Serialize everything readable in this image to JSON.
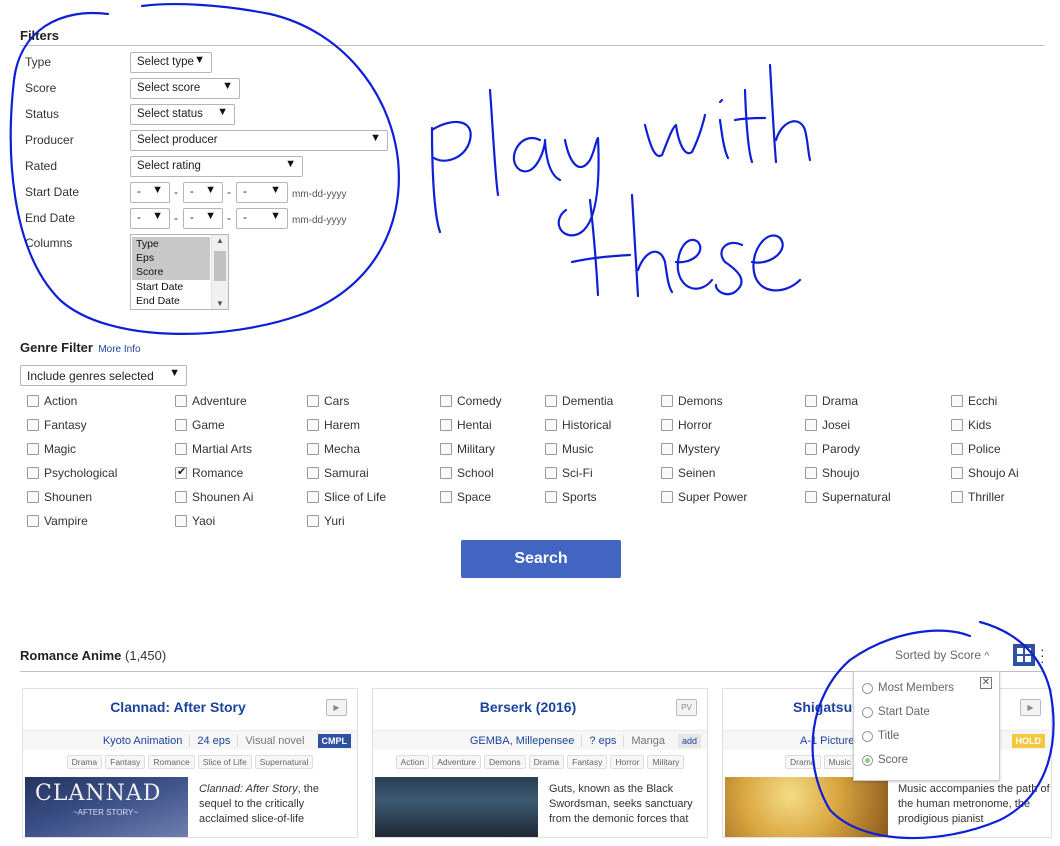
{
  "filters": {
    "heading": "Filters",
    "type": {
      "label": "Type",
      "value": "Select type"
    },
    "score": {
      "label": "Score",
      "value": "Select score"
    },
    "status": {
      "label": "Status",
      "value": "Select status"
    },
    "producer": {
      "label": "Producer",
      "value": "Select producer"
    },
    "rated": {
      "label": "Rated",
      "value": "Select rating"
    },
    "start_date": {
      "label": "Start Date",
      "month": "-",
      "day": "-",
      "year": "-",
      "format": "mm-dd-yyyy"
    },
    "end_date": {
      "label": "End Date",
      "month": "-",
      "day": "-",
      "year": "-",
      "format": "mm-dd-yyyy"
    },
    "columns": {
      "label": "Columns",
      "options": [
        "Type",
        "Eps",
        "Score",
        "Start Date",
        "End Date"
      ],
      "selected": [
        "Type",
        "Eps",
        "Score"
      ]
    }
  },
  "genre_filter": {
    "heading": "Genre Filter",
    "more_info": "More Info",
    "mode": "Include genres selected",
    "genres": [
      "Action",
      "Adventure",
      "Cars",
      "Comedy",
      "Dementia",
      "Demons",
      "Drama",
      "Ecchi",
      "Fantasy",
      "Game",
      "Harem",
      "Hentai",
      "Historical",
      "Horror",
      "Josei",
      "Kids",
      "Magic",
      "Martial Arts",
      "Mecha",
      "Military",
      "Music",
      "Mystery",
      "Parody",
      "Police",
      "Psychological",
      "Romance",
      "Samurai",
      "School",
      "Sci-Fi",
      "Seinen",
      "Shoujo",
      "Shoujo Ai",
      "Shounen",
      "Shounen Ai",
      "Slice of Life",
      "Space",
      "Sports",
      "Super Power",
      "Supernatural",
      "Thriller",
      "Vampire",
      "Yaoi",
      "Yuri"
    ],
    "checked": [
      "Romance"
    ]
  },
  "search_button": "Search",
  "results": {
    "heading": "Romance Anime",
    "count": "(1,450)",
    "sort_label": "Sorted by Score",
    "sort_options": [
      "Most Members",
      "Start Date",
      "Title",
      "Score"
    ],
    "sort_selected": "Score"
  },
  "cards": [
    {
      "title": "Clannad: After Story",
      "studio": "Kyoto Animation",
      "eps": "24 eps",
      "source": "Visual novel",
      "badge": "CMPL",
      "tags": [
        "Drama",
        "Fantasy",
        "Romance",
        "Slice of Life",
        "Supernatural"
      ],
      "thumb_text": "CLANNAD",
      "thumb_sub": "~AFTER STORY~",
      "synopsis_em": "Clannad: After Story",
      "synopsis": ", the sequel to the critically acclaimed slice-of-life"
    },
    {
      "title": "Berserk (2016)",
      "studio": "GEMBA, Millepensee",
      "eps": "? eps",
      "source": "Manga",
      "badge": "add",
      "tags": [
        "Action",
        "Adventure",
        "Demons",
        "Drama",
        "Fantasy",
        "Horror",
        "Military"
      ],
      "synopsis": "Guts, known as the Black Swordsman, seeks sanctuary from the demonic forces that"
    },
    {
      "title": "Shigatsu",
      "studio": "A-1 Pictures",
      "badge": "HOLD",
      "tags": [
        "Drama",
        "Music"
      ],
      "synopsis": "Music accompanies the path of the human metronome, the prodigious pianist"
    }
  ],
  "annotation": {
    "line1": "play with",
    "line2": "these",
    "ink_color": "#0f1fd6"
  },
  "colors": {
    "accent": "#4165c0",
    "link": "#1c439b",
    "badge_cmpl": "#2e51a2",
    "badge_hold": "#f1c83e"
  }
}
